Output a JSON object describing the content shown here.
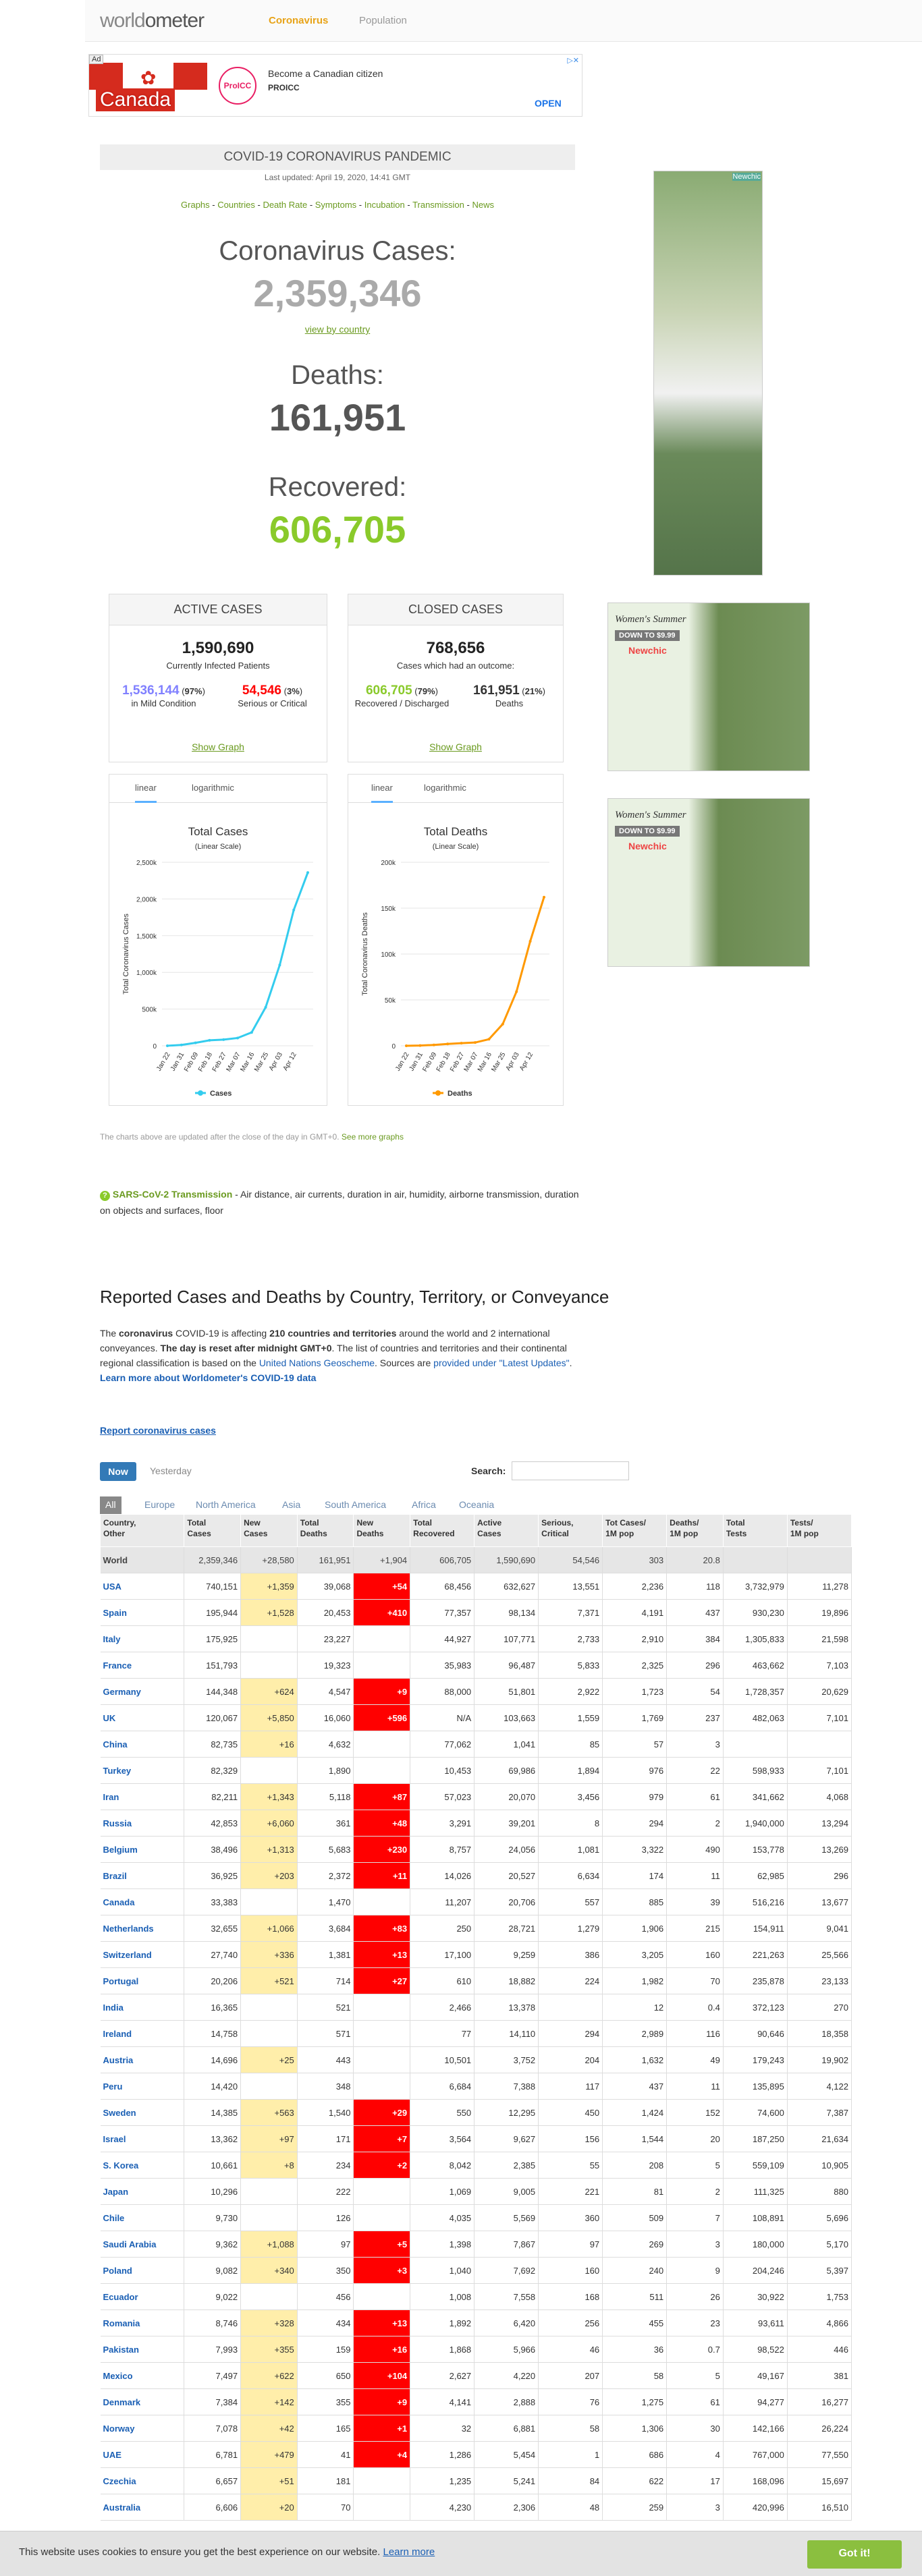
{
  "nav": {
    "logo_a": "world",
    "logo_b": "ometer",
    "tab_active": "Coronavirus",
    "tab_other": "Population"
  },
  "ad": {
    "badge": "Ad",
    "country": "Canada",
    "logo": "ProICC",
    "title": "Become a Canadian citizen",
    "sub": "PROICC",
    "open": "OPEN"
  },
  "header": {
    "title": "COVID-19 CORONAVIRUS PANDEMIC",
    "updated": "Last updated: April 19, 2020, 14:41 GMT"
  },
  "links": [
    "Graphs",
    "Countries",
    "Death Rate",
    "Symptoms",
    "Incubation",
    "Transmission",
    "News"
  ],
  "counters": {
    "cases_label": "Coronavirus Cases:",
    "cases": "2,359,346",
    "view_by_country": "view by country",
    "deaths_label": "Deaths:",
    "deaths": "161,951",
    "recovered_label": "Recovered:",
    "recovered": "606,705"
  },
  "active": {
    "title": "ACTIVE CASES",
    "total": "1,590,690",
    "total_label": "Currently Infected Patients",
    "mild": "1,536,144",
    "mild_pct": "97%",
    "mild_label": "in Mild Condition",
    "serious": "54,546",
    "serious_pct": "3%",
    "serious_label": "Serious or Critical",
    "show_graph": "Show Graph"
  },
  "closed": {
    "title": "CLOSED CASES",
    "total": "768,656",
    "total_label": "Cases which had an outcome:",
    "rec": "606,705",
    "rec_pct": "79%",
    "rec_label": "Recovered / Discharged",
    "deaths": "161,951",
    "deaths_pct": "21%",
    "deaths_label": "Deaths",
    "show_graph": "Show Graph"
  },
  "charts_tabs": {
    "linear": "linear",
    "log": "logarithmic"
  },
  "chart_data": [
    {
      "type": "line",
      "title": "Total Cases",
      "subtitle": "(Linear Scale)",
      "ylabel": "Total Coronavirus Cases",
      "legend": "Cases",
      "color": "#33ccee",
      "x": [
        "Jan 22",
        "Jan 31",
        "Feb 09",
        "Feb 18",
        "Feb 27",
        "Mar 07",
        "Mar 16",
        "Mar 25",
        "Apr 03",
        "Apr 12"
      ],
      "ticks": [
        "0",
        "500k",
        "1,000k",
        "1,500k",
        "2,000k",
        "2,500k"
      ],
      "ylim": [
        0,
        2500000
      ],
      "values": [
        555,
        11950,
        40000,
        75000,
        84000,
        106000,
        182000,
        525000,
        1100000,
        1850000
      ],
      "last": 2359346
    },
    {
      "type": "line",
      "title": "Total Deaths",
      "subtitle": "(Linear Scale)",
      "ylabel": "Total Coronavirus Deaths",
      "legend": "Deaths",
      "color": "#ff9900",
      "x": [
        "Jan 22",
        "Jan 31",
        "Feb 09",
        "Feb 18",
        "Feb 27",
        "Mar 07",
        "Mar 16",
        "Mar 25",
        "Apr 03",
        "Apr 12"
      ],
      "ticks": [
        "0",
        "50k",
        "100k",
        "150k",
        "200k"
      ],
      "ylim": [
        0,
        200000
      ],
      "values": [
        17,
        259,
        910,
        2010,
        2860,
        3560,
        7150,
        23600,
        59000,
        114000
      ],
      "last": 161951
    }
  ],
  "note": {
    "text": "The charts above are updated after the close of the day in GMT+0.",
    "link": "See more graphs"
  },
  "transmission": {
    "link": "SARS-CoV-2 Transmission",
    "text": " - Air distance, air currents, duration in air, humidity, airborne transmission, duration on objects and surfaces, floor"
  },
  "section": {
    "title": "Reported Cases and Deaths by Country, Territory, or Conveyance",
    "p1": "The ",
    "b1": "coronavirus",
    "p2": " COVID-19 is affecting ",
    "b2": "210 countries and territories",
    "p3": " around the world and 2 international conveyances. ",
    "b3": "The day is reset after midnight GMT+0",
    "p4": ". The list of countries and territories and their continental regional classification is based on the ",
    "l1": "United Nations Geoscheme",
    "p5": ". Sources are ",
    "l2": "provided under \"Latest Updates\"",
    "p6": ".",
    "l3": "Learn more about Worldometer's COVID-19 data"
  },
  "report": "Report coronavirus cases",
  "controls": {
    "now": "Now",
    "yesterday": "Yesterday",
    "search": "Search:"
  },
  "regions": [
    "All",
    "Europe",
    "North America",
    "Asia",
    "South America",
    "Africa",
    "Oceania"
  ],
  "table": {
    "headers": [
      "Country,\nOther",
      "Total\nCases",
      "New\nCases",
      "Total\nDeaths",
      "New\nDeaths",
      "Total\nRecovered",
      "Active\nCases",
      "Serious,\nCritical",
      "Tot Cases/\n1M pop",
      "Deaths/\n1M pop",
      "Total\nTests",
      "Tests/\n1M pop"
    ],
    "world": [
      "World",
      "2,359,346",
      "+28,580",
      "161,951",
      "+1,904",
      "606,705",
      "1,590,690",
      "54,546",
      "303",
      "20.8",
      "",
      ""
    ],
    "rows": [
      [
        "USA",
        "740,151",
        "+1,359",
        "39,068",
        "+54",
        "68,456",
        "632,627",
        "13,551",
        "2,236",
        "118",
        "3,732,979",
        "11,278"
      ],
      [
        "Spain",
        "195,944",
        "+1,528",
        "20,453",
        "+410",
        "77,357",
        "98,134",
        "7,371",
        "4,191",
        "437",
        "930,230",
        "19,896"
      ],
      [
        "Italy",
        "175,925",
        "",
        "23,227",
        "",
        "44,927",
        "107,771",
        "2,733",
        "2,910",
        "384",
        "1,305,833",
        "21,598"
      ],
      [
        "France",
        "151,793",
        "",
        "19,323",
        "",
        "35,983",
        "96,487",
        "5,833",
        "2,325",
        "296",
        "463,662",
        "7,103"
      ],
      [
        "Germany",
        "144,348",
        "+624",
        "4,547",
        "+9",
        "88,000",
        "51,801",
        "2,922",
        "1,723",
        "54",
        "1,728,357",
        "20,629"
      ],
      [
        "UK",
        "120,067",
        "+5,850",
        "16,060",
        "+596",
        "N/A",
        "103,663",
        "1,559",
        "1,769",
        "237",
        "482,063",
        "7,101"
      ],
      [
        "China",
        "82,735",
        "+16",
        "4,632",
        "",
        "77,062",
        "1,041",
        "85",
        "57",
        "3",
        "",
        ""
      ],
      [
        "Turkey",
        "82,329",
        "",
        "1,890",
        "",
        "10,453",
        "69,986",
        "1,894",
        "976",
        "22",
        "598,933",
        "7,101"
      ],
      [
        "Iran",
        "82,211",
        "+1,343",
        "5,118",
        "+87",
        "57,023",
        "20,070",
        "3,456",
        "979",
        "61",
        "341,662",
        "4,068"
      ],
      [
        "Russia",
        "42,853",
        "+6,060",
        "361",
        "+48",
        "3,291",
        "39,201",
        "8",
        "294",
        "2",
        "1,940,000",
        "13,294"
      ],
      [
        "Belgium",
        "38,496",
        "+1,313",
        "5,683",
        "+230",
        "8,757",
        "24,056",
        "1,081",
        "3,322",
        "490",
        "153,778",
        "13,269"
      ],
      [
        "Brazil",
        "36,925",
        "+203",
        "2,372",
        "+11",
        "14,026",
        "20,527",
        "6,634",
        "174",
        "11",
        "62,985",
        "296"
      ],
      [
        "Canada",
        "33,383",
        "",
        "1,470",
        "",
        "11,207",
        "20,706",
        "557",
        "885",
        "39",
        "516,216",
        "13,677"
      ],
      [
        "Netherlands",
        "32,655",
        "+1,066",
        "3,684",
        "+83",
        "250",
        "28,721",
        "1,279",
        "1,906",
        "215",
        "154,911",
        "9,041"
      ],
      [
        "Switzerland",
        "27,740",
        "+336",
        "1,381",
        "+13",
        "17,100",
        "9,259",
        "386",
        "3,205",
        "160",
        "221,263",
        "25,566"
      ],
      [
        "Portugal",
        "20,206",
        "+521",
        "714",
        "+27",
        "610",
        "18,882",
        "224",
        "1,982",
        "70",
        "235,878",
        "23,133"
      ],
      [
        "India",
        "16,365",
        "",
        "521",
        "",
        "2,466",
        "13,378",
        "",
        "12",
        "0.4",
        "372,123",
        "270"
      ],
      [
        "Ireland",
        "14,758",
        "",
        "571",
        "",
        "77",
        "14,110",
        "294",
        "2,989",
        "116",
        "90,646",
        "18,358"
      ],
      [
        "Austria",
        "14,696",
        "+25",
        "443",
        "",
        "10,501",
        "3,752",
        "204",
        "1,632",
        "49",
        "179,243",
        "19,902"
      ],
      [
        "Peru",
        "14,420",
        "",
        "348",
        "",
        "6,684",
        "7,388",
        "117",
        "437",
        "11",
        "135,895",
        "4,122"
      ],
      [
        "Sweden",
        "14,385",
        "+563",
        "1,540",
        "+29",
        "550",
        "12,295",
        "450",
        "1,424",
        "152",
        "74,600",
        "7,387"
      ],
      [
        "Israel",
        "13,362",
        "+97",
        "171",
        "+7",
        "3,564",
        "9,627",
        "156",
        "1,544",
        "20",
        "187,250",
        "21,634"
      ],
      [
        "S. Korea",
        "10,661",
        "+8",
        "234",
        "+2",
        "8,042",
        "2,385",
        "55",
        "208",
        "5",
        "559,109",
        "10,905"
      ],
      [
        "Japan",
        "10,296",
        "",
        "222",
        "",
        "1,069",
        "9,005",
        "221",
        "81",
        "2",
        "111,325",
        "880"
      ],
      [
        "Chile",
        "9,730",
        "",
        "126",
        "",
        "4,035",
        "5,569",
        "360",
        "509",
        "7",
        "108,891",
        "5,696"
      ],
      [
        "Saudi Arabia",
        "9,362",
        "+1,088",
        "97",
        "+5",
        "1,398",
        "7,867",
        "97",
        "269",
        "3",
        "180,000",
        "5,170"
      ],
      [
        "Poland",
        "9,082",
        "+340",
        "350",
        "+3",
        "1,040",
        "7,692",
        "160",
        "240",
        "9",
        "204,246",
        "5,397"
      ],
      [
        "Ecuador",
        "9,022",
        "",
        "456",
        "",
        "1,008",
        "7,558",
        "168",
        "511",
        "26",
        "30,922",
        "1,753"
      ],
      [
        "Romania",
        "8,746",
        "+328",
        "434",
        "+13",
        "1,892",
        "6,420",
        "256",
        "455",
        "23",
        "93,611",
        "4,866"
      ],
      [
        "Pakistan",
        "7,993",
        "+355",
        "159",
        "+16",
        "1,868",
        "5,966",
        "46",
        "36",
        "0.7",
        "98,522",
        "446"
      ],
      [
        "Mexico",
        "7,497",
        "+622",
        "650",
        "+104",
        "2,627",
        "4,220",
        "207",
        "58",
        "5",
        "49,167",
        "381"
      ],
      [
        "Denmark",
        "7,384",
        "+142",
        "355",
        "+9",
        "4,141",
        "2,888",
        "76",
        "1,275",
        "61",
        "94,277",
        "16,277"
      ],
      [
        "Norway",
        "7,078",
        "+42",
        "165",
        "+1",
        "32",
        "6,881",
        "58",
        "1,306",
        "30",
        "142,166",
        "26,224"
      ],
      [
        "UAE",
        "6,781",
        "+479",
        "41",
        "+4",
        "1,286",
        "5,454",
        "1",
        "686",
        "4",
        "767,000",
        "77,550"
      ],
      [
        "Czechia",
        "6,657",
        "+51",
        "181",
        "",
        "1,235",
        "5,241",
        "84",
        "622",
        "17",
        "168,096",
        "15,697"
      ],
      [
        "Australia",
        "6,606",
        "+20",
        "70",
        "",
        "4,230",
        "2,306",
        "48",
        "259",
        "3",
        "420,996",
        "16,510"
      ]
    ]
  },
  "cookie": {
    "text": "This website uses cookies to ensure you get the best experience on our website.",
    "link": "Learn more",
    "button": "Got it!"
  },
  "side_ads": {
    "ad2_line1": "Women's Summer",
    "ad2_line2": "DOWN TO $9.99",
    "ad2_brand": "Newchic",
    "ad3_line1": "Women's Summer",
    "ad3_line2": "DOWN TO $9.99",
    "ad3_brand": "Newchic",
    "ad1_brand": "Newchic"
  }
}
